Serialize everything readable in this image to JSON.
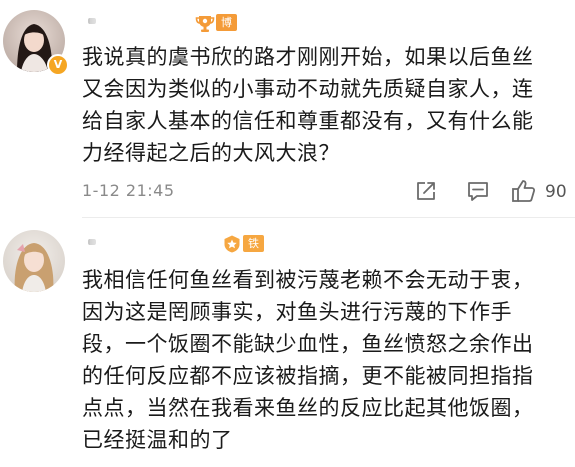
{
  "comments": [
    {
      "username": "",
      "badge": {
        "icon": "boss-trophy-icon",
        "label": "博主"
      },
      "verified_icon": "v-verified-icon",
      "text": "我说真的虞书欣的路才刚刚开始，如果以后鱼丝又会因为类似的小事动不动就先质疑自家人，连给自家人基本的信任和尊重都没有，又有什么能力经得起之后的大风大浪？",
      "text_lines": [
        "我说真的虞书欣的路才刚刚开始，如果以后鱼丝",
        "又会因为类似的小事动不动就先质疑自家人，连",
        "给自家人基本的信任和尊重都没有，又有什么能",
        "力经得起之后的大风大浪？"
      ],
      "time": "1-12 21:45",
      "likes": "90",
      "icons": {
        "share": "share-icon",
        "comment": "comment-icon",
        "like": "thumbs-up-icon"
      }
    },
    {
      "username": "",
      "badge": {
        "icon": "fan-badge-icon",
        "label": "铁粉"
      },
      "text": "我相信任何鱼丝看到被污蔑老赖不会无动于衷，因为这是罔顾事实，对鱼头进行污蔑的下作手段，一个饭圈不能缺少血性，鱼丝愤怒之余作出的任何反应都不应该被指摘，更不能被同担指指点点，当然在我看来鱼丝的反应比起其他饭圈，已经挺温和的了",
      "text_lines": [
        "我相信任何鱼丝看到被污蔑老赖不会无动于衷，",
        "因为这是罔顾事实，对鱼头进行污蔑的下作手",
        "段，一个饭圈不能缺少血性，鱼丝愤怒之余作出",
        "的任何反应都不应该被指摘，更不能被同担指指",
        "点点，当然在我看来鱼丝的反应比起其他饭圈，",
        "已经挺温和的了"
      ]
    }
  ],
  "colors": {
    "username": "#eb7350",
    "boss_badge": "#f49b38",
    "fan_badge": "#f6a741",
    "meta_text": "#8a8a8a",
    "icon_stroke": "#6b6b6b"
  }
}
